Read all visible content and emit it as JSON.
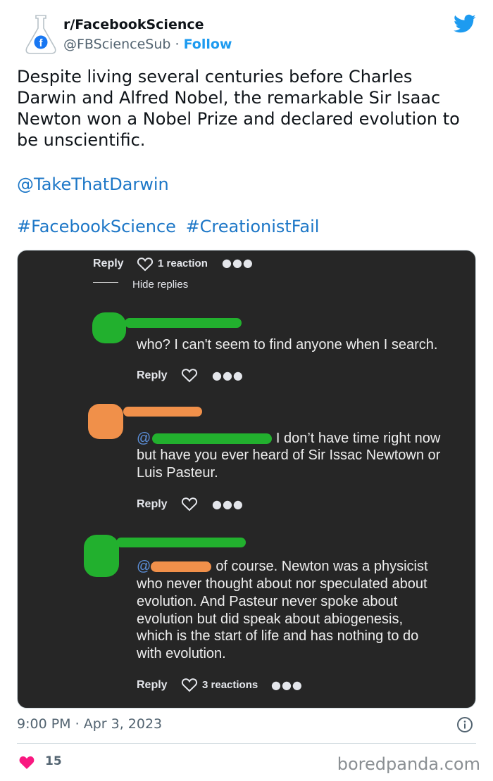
{
  "account": {
    "name": "r/FacebookScience",
    "handle": "@FBScienceSub",
    "separator": "·",
    "follow_label": "Follow",
    "brand_color": "#1d9bf0"
  },
  "tweet": {
    "text": "Despite living several centuries before Charles Darwin and Alfred Nobel, the remarkable Sir Isaac Newton won a Nobel Prize and declared evolution to be unscientific.",
    "mention": "@TakeThatDarwin",
    "hashtags": [
      "#FacebookScience",
      "#CreationistFail"
    ]
  },
  "screenshot": {
    "top_bar": {
      "reply": "Reply",
      "reactions": "1 reaction",
      "hide_replies": "Hide replies"
    },
    "comments": [
      {
        "text": "who? I can't seem to find anyone when I search.",
        "reply": "Reply"
      },
      {
        "at": "@",
        "line1_rest": " I don’t have time right now",
        "line2": "but have you ever heard of Sir Issac Newtown or",
        "line3": "Luis Pasteur.",
        "reply": "Reply"
      },
      {
        "at": "@",
        "line1_rest": "of course. Newton was a physicist",
        "lines": [
          "who never thought about nor speculated about",
          "evolution. And Pasteur never spoke about",
          "evolution but did speak about abiogenesis,",
          "which is the start of life and has nothing to do",
          "with evolution."
        ],
        "reply": "Reply",
        "reactions": "3 reactions"
      }
    ]
  },
  "footer": {
    "time": "9:00 PM",
    "separator": "·",
    "date": "Apr 3, 2023",
    "likes": "15",
    "like_color": "#f91880",
    "watermark": "boredpanda.com"
  }
}
